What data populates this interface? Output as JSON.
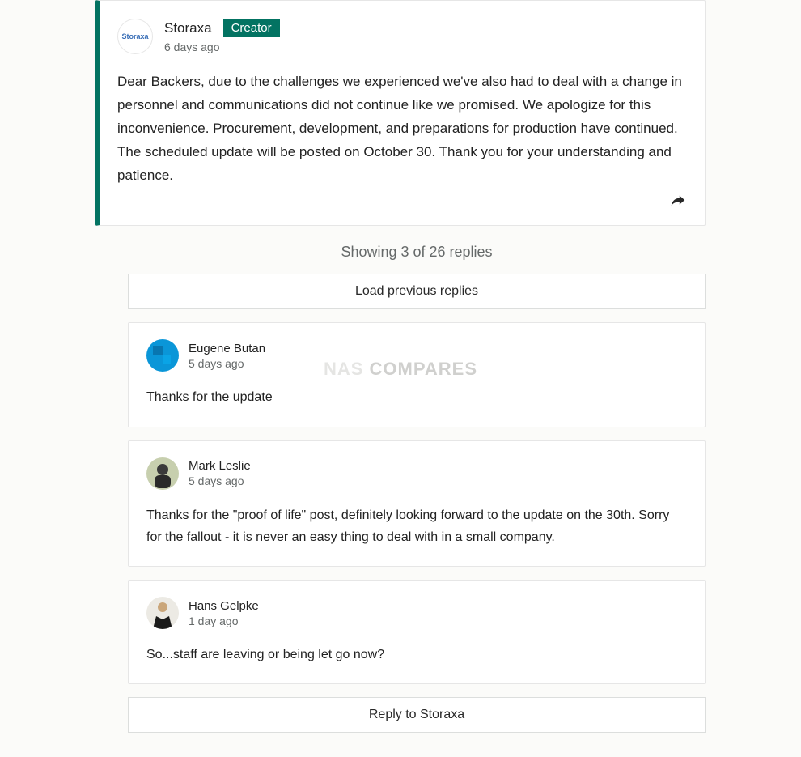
{
  "creator": {
    "name": "Storaxa",
    "badge": "Creator",
    "avatar_text": "Storaxa",
    "time": "6 days ago",
    "body": "Dear Backers, due to the challenges we experienced we've also had to deal with a change in personnel and communications did not continue like we promised. We apologize for this inconvenience. Procurement, development, and preparations for production have continued. The scheduled update will be posted on October 30. Thank you for your understanding and patience."
  },
  "replies_summary": {
    "text": "Showing 3 of 26 replies",
    "shown": 3,
    "total": 26
  },
  "buttons": {
    "load_previous": "Load previous replies",
    "reply_to": "Reply to Storaxa"
  },
  "replies": [
    {
      "name": "Eugene Butan",
      "time": "5 days ago",
      "body": "Thanks for the update",
      "avatar_color": "#0a96d8"
    },
    {
      "name": "Mark Leslie",
      "time": "5 days ago",
      "body": "Thanks for the \"proof of life\" post, definitely looking forward to the update on the 30th. Sorry for the fallout - it is never an easy thing to deal with in a small company.",
      "avatar_color": "#c9b86a"
    },
    {
      "name": "Hans Gelpke",
      "time": "1 day ago",
      "body": "So...staff are leaving or being let go now?",
      "avatar_color": "#d8d5ce"
    }
  ],
  "watermark": {
    "part1": "NAS ",
    "part2": "COMPARES"
  }
}
